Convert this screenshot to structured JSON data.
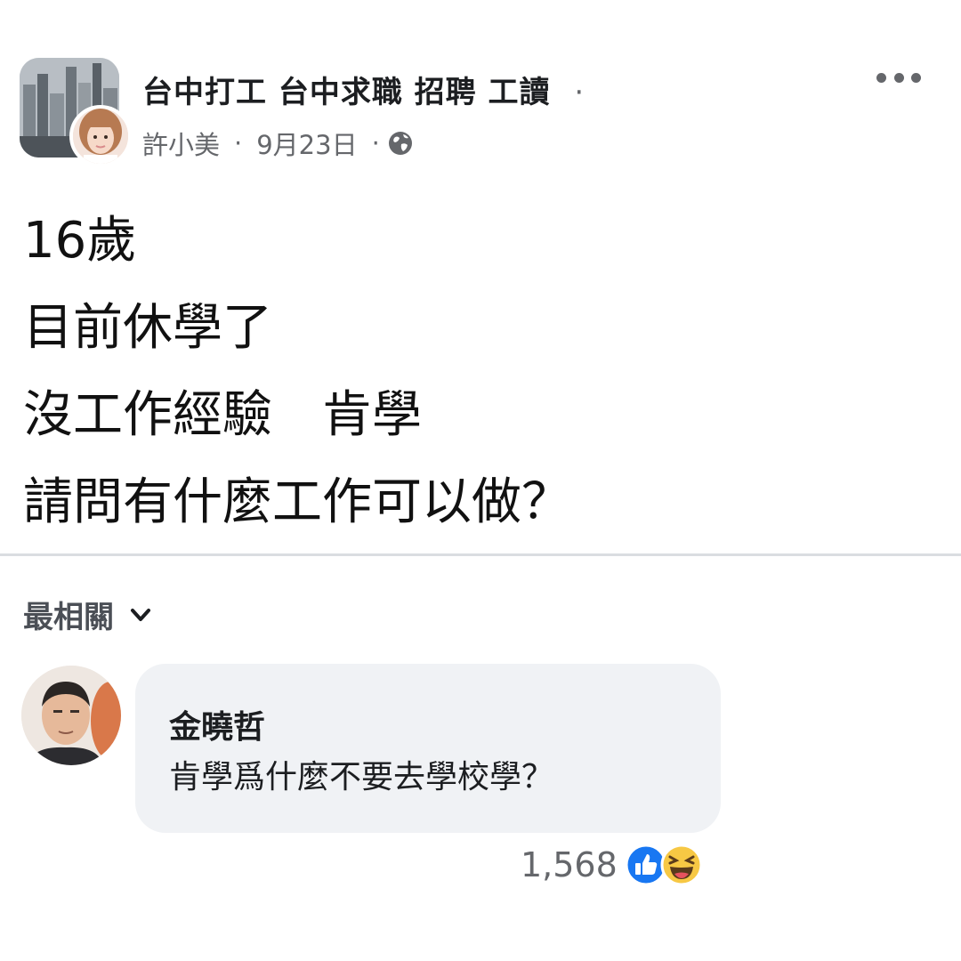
{
  "post": {
    "group_name": "台中打工 台中求職 招聘 工讀",
    "author": "許小美",
    "separator": "·",
    "date": "9月23日",
    "lines": [
      "16歲",
      "目前休學了",
      "沒工作經驗　肯學",
      "請問有什麼工作可以做？"
    ]
  },
  "comments_section": {
    "sort_label": "最相關"
  },
  "comment": {
    "author": "金曉哲",
    "text": "肯學爲什麼不要去學校學？",
    "reaction_count": "1,568",
    "reactions": [
      "like-icon",
      "haha-icon"
    ]
  },
  "colors": {
    "secondary_text": "#65676b",
    "bubble_bg": "#f0f2f5",
    "like_blue": "#1877f2",
    "haha_yellow": "#f7c844"
  }
}
